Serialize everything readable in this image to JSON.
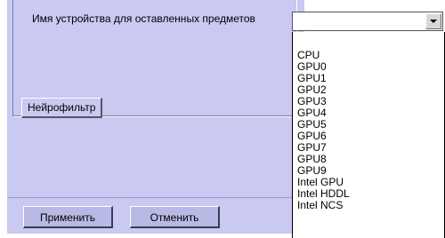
{
  "form": {
    "field_label": "Имя устройства для оставленных предметов",
    "tab_label": "Нейрофильтр",
    "apply_button": "Применить",
    "cancel_button": "Отменить"
  },
  "combo": {
    "value": ""
  },
  "dropdown": {
    "items": [
      "CPU",
      "GPU0",
      "GPU1",
      "GPU2",
      "GPU3",
      "GPU4",
      "GPU5",
      "GPU6",
      "GPU7",
      "GPU8",
      "GPU9",
      "Intel GPU",
      "Intel HDDL",
      "Intel NCS"
    ]
  }
}
